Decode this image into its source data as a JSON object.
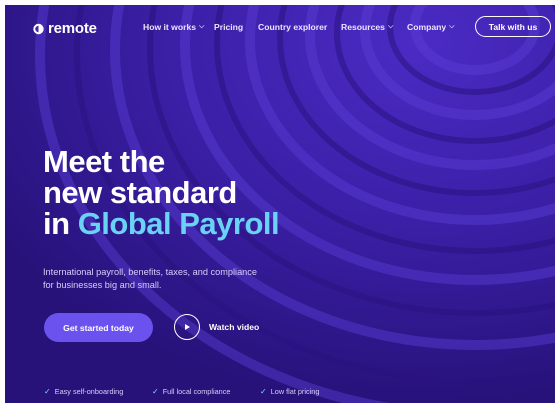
{
  "nav": {
    "logo": "remote",
    "items": [
      {
        "label": "How it works",
        "dropdown": true
      },
      {
        "label": "Pricing",
        "dropdown": false
      },
      {
        "label": "Country explorer",
        "dropdown": false
      },
      {
        "label": "Resources",
        "dropdown": true
      },
      {
        "label": "Company",
        "dropdown": true
      }
    ],
    "cta": "Talk with us"
  },
  "hero": {
    "title_line1": "Meet the",
    "title_line2": "new standard",
    "title_line3_prefix": "in",
    "title_line3_accent": "Global Payroll",
    "subtitle_line1": "International payroll, benefits, taxes, and compliance",
    "subtitle_line2": "for businesses big and small.",
    "primary_cta": "Get started today",
    "secondary_cta": "Watch video"
  },
  "features": [
    {
      "label": "Easy self-onboarding",
      "icon": "check-icon"
    },
    {
      "label": "Full local compliance",
      "icon": "check-icon"
    },
    {
      "label": "Low flat pricing",
      "icon": "check-icon"
    }
  ],
  "colors": {
    "background": "#3a1a9c",
    "accent_text": "#6ad3f5",
    "primary_button": "#6b52ef"
  },
  "chevron": "⌵"
}
